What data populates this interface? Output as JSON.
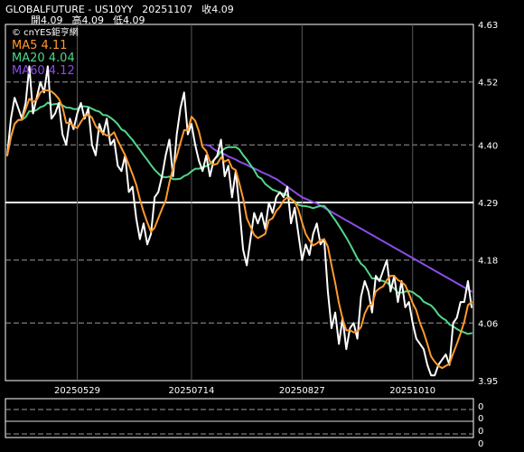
{
  "header": {
    "symbol": "GLOBALFUTURE - US10YY",
    "date": "20251107",
    "close_label": "收4.09",
    "open_label": "開4.09",
    "high_label": "高4.09",
    "low_label": "低4.09"
  },
  "watermark": "© cnYES鉅亨網",
  "legend": [
    {
      "label": "MA5 4.11",
      "color": "#ff9a2e"
    },
    {
      "label": "MA20 4.04",
      "color": "#52d68a"
    },
    {
      "label": "MA60 4.12",
      "color": "#8a4de8"
    }
  ],
  "colors": {
    "price": "#ffffff",
    "ma5": "#ff9a2e",
    "ma20": "#52d68a",
    "ma60": "#8a4de8"
  },
  "chart_data": {
    "type": "line",
    "x_ticks": [
      {
        "label": "20250529",
        "index": 19
      },
      {
        "label": "20250714",
        "index": 50
      },
      {
        "label": "20250827",
        "index": 80
      },
      {
        "label": "20251010",
        "index": 110
      }
    ],
    "y_ticks": [
      {
        "label": "4.63",
        "value": 4.63
      },
      {
        "label": "4.52",
        "value": 4.52
      },
      {
        "label": "4.40",
        "value": 4.4
      },
      {
        "label": "4.29",
        "value": 4.29
      },
      {
        "label": "4.18",
        "value": 4.18
      },
      {
        "label": "4.06",
        "value": 4.06
      },
      {
        "label": "3.95",
        "value": 3.95
      }
    ],
    "ylim": [
      3.95,
      4.63
    ],
    "highlight_value": 4.29,
    "x_count": 127,
    "grid": true,
    "price": [
      4.38,
      4.45,
      4.49,
      4.47,
      4.45,
      4.48,
      4.55,
      4.46,
      4.49,
      4.52,
      4.5,
      4.55,
      4.45,
      4.46,
      4.48,
      4.42,
      4.4,
      4.45,
      4.43,
      4.46,
      4.48,
      4.45,
      4.47,
      4.4,
      4.38,
      4.44,
      4.42,
      4.45,
      4.4,
      4.41,
      4.36,
      4.35,
      4.38,
      4.31,
      4.32,
      4.26,
      4.22,
      4.25,
      4.21,
      4.23,
      4.3,
      4.31,
      4.34,
      4.38,
      4.41,
      4.34,
      4.42,
      4.47,
      4.5,
      4.42,
      4.44,
      4.4,
      4.37,
      4.35,
      4.38,
      4.34,
      4.37,
      4.38,
      4.41,
      4.34,
      4.36,
      4.3,
      4.35,
      4.28,
      4.2,
      4.17,
      4.22,
      4.27,
      4.25,
      4.27,
      4.24,
      4.29,
      4.27,
      4.3,
      4.31,
      4.3,
      4.32,
      4.25,
      4.28,
      4.23,
      4.18,
      4.21,
      4.19,
      4.23,
      4.25,
      4.21,
      4.22,
      4.12,
      4.05,
      4.08,
      4.02,
      4.07,
      4.01,
      4.05,
      4.06,
      4.03,
      4.11,
      4.14,
      4.12,
      4.08,
      4.15,
      4.14,
      4.16,
      4.18,
      4.12,
      4.15,
      4.1,
      4.14,
      4.09,
      4.1,
      4.06,
      4.03,
      4.02,
      4.01,
      3.98,
      3.96,
      3.96,
      3.98,
      3.99,
      4.0,
      3.98,
      4.06,
      4.07,
      4.1,
      4.1,
      4.14,
      4.09
    ],
    "series": [
      {
        "name": "MA5",
        "values": [
          4.38,
          4.415,
          4.44,
          4.4475,
          4.448,
          4.468,
          4.488,
          4.482,
          4.486,
          4.5,
          4.504,
          4.504,
          4.502,
          4.496,
          4.488,
          4.472,
          4.442,
          4.442,
          4.436,
          4.432,
          4.444,
          4.454,
          4.458,
          4.452,
          4.436,
          4.428,
          4.422,
          4.418,
          4.418,
          4.424,
          4.408,
          4.394,
          4.38,
          4.362,
          4.344,
          4.324,
          4.296,
          4.272,
          4.252,
          4.234,
          4.242,
          4.26,
          4.278,
          4.294,
          4.328,
          4.356,
          4.378,
          4.404,
          4.428,
          4.428,
          4.454,
          4.446,
          4.426,
          4.396,
          4.388,
          4.368,
          4.362,
          4.364,
          4.376,
          4.368,
          4.372,
          4.356,
          4.352,
          4.326,
          4.298,
          4.26,
          4.244,
          4.228,
          4.222,
          4.226,
          4.23,
          4.256,
          4.26,
          4.274,
          4.282,
          4.294,
          4.3,
          4.296,
          4.292,
          4.276,
          4.252,
          4.23,
          4.218,
          4.208,
          4.212,
          4.218,
          4.22,
          4.206,
          4.17,
          4.136,
          4.098,
          4.068,
          4.046,
          4.046,
          4.042,
          4.044,
          4.052,
          4.078,
          4.092,
          4.096,
          4.12,
          4.126,
          4.13,
          4.142,
          4.15,
          4.15,
          4.142,
          4.138,
          4.132,
          4.116,
          4.098,
          4.084,
          4.06,
          4.042,
          4.02,
          3.996,
          3.986,
          3.978,
          3.974,
          3.978,
          3.982,
          4.002,
          4.02,
          4.04,
          4.062,
          4.094,
          4.1
        ]
      },
      {
        "name": "MA20",
        "values": [
          4.38,
          4.415,
          4.44,
          4.4475,
          4.448,
          4.453,
          4.4643,
          4.4638,
          4.4667,
          4.472,
          4.4745,
          4.4808,
          4.4769,
          4.4779,
          4.4787,
          4.4756,
          4.4712,
          4.4711,
          4.4684,
          4.4685,
          4.4735,
          4.4735,
          4.4725,
          4.469,
          4.4655,
          4.4635,
          4.457,
          4.4565,
          4.452,
          4.4465,
          4.4395,
          4.4295,
          4.426,
          4.4175,
          4.4095,
          4.3995,
          4.3905,
          4.3805,
          4.3715,
          4.3615,
          4.3525,
          4.3455,
          4.339,
          4.338,
          4.3395,
          4.3345,
          4.3345,
          4.3355,
          4.3405,
          4.3435,
          4.3495,
          4.3545,
          4.3545,
          4.3565,
          4.3595,
          4.3635,
          4.371,
          4.3775,
          4.3875,
          4.393,
          4.396,
          4.3955,
          4.396,
          4.391,
          4.3805,
          4.372,
          4.362,
          4.352,
          4.3395,
          4.3355,
          4.3255,
          4.32,
          4.3145,
          4.312,
          4.3085,
          4.3065,
          4.304,
          4.2975,
          4.291,
          4.2855,
          4.2835,
          4.283,
          4.2815,
          4.279,
          4.2815,
          4.2835,
          4.2835,
          4.276,
          4.266,
          4.2565,
          4.2455,
          4.2345,
          4.223,
          4.2105,
          4.197,
          4.1835,
          4.173,
          4.167,
          4.156,
          4.145,
          4.145,
          4.1415,
          4.14,
          4.1375,
          4.131,
          4.126,
          4.1175,
          4.118,
          4.12,
          4.121,
          4.119,
          4.1135,
          4.109,
          4.1005,
          4.097,
          4.0935,
          4.086,
          4.076,
          4.0695,
          4.0655,
          4.057,
          4.0535,
          4.0485,
          4.0445,
          4.042,
          4.039,
          4.0405
        ]
      },
      {
        "name": "MA60",
        "values": [
          null,
          null,
          null,
          null,
          null,
          null,
          null,
          null,
          null,
          null,
          null,
          null,
          null,
          null,
          null,
          null,
          null,
          null,
          null,
          null,
          null,
          null,
          null,
          null,
          null,
          null,
          null,
          null,
          null,
          null,
          null,
          null,
          null,
          null,
          null,
          null,
          null,
          null,
          null,
          null,
          null,
          null,
          null,
          null,
          null,
          null,
          null,
          null,
          null,
          null,
          null,
          null,
          null,
          null,
          4.4,
          4.398,
          4.392,
          4.388,
          4.385,
          4.382,
          4.378,
          4.375,
          4.372,
          4.368,
          4.365,
          4.362,
          4.358,
          4.355,
          4.352,
          4.348,
          4.345,
          4.342,
          4.338,
          4.335,
          4.33,
          4.325,
          4.32,
          4.315,
          4.31,
          4.305,
          4.3,
          4.297,
          4.294,
          4.291,
          4.288,
          4.284,
          4.28,
          4.276,
          4.272,
          4.268,
          4.264,
          4.26,
          4.256,
          4.252,
          4.248,
          4.244,
          4.24,
          4.236,
          4.232,
          4.228,
          4.224,
          4.22,
          4.216,
          4.212,
          4.208,
          4.204,
          4.2,
          4.196,
          4.192,
          4.188,
          4.184,
          4.18,
          4.176,
          4.172,
          4.168,
          4.164,
          4.16,
          4.156,
          4.152,
          4.148,
          4.144,
          4.14,
          4.136,
          4.132,
          4.128,
          4.124,
          4.12
        ]
      }
    ],
    "subpanel_ticks": [
      "0",
      "0",
      "0",
      "0"
    ]
  }
}
